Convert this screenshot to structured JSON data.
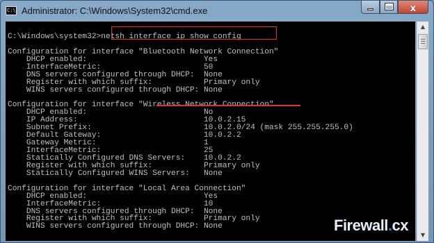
{
  "window": {
    "title": "Administrator: C:\\Windows\\System32\\cmd.exe",
    "icon": "cmd-icon",
    "controls": {
      "minimize": "minimize-icon",
      "maximize": "maximize-icon",
      "close_glyph": "x"
    }
  },
  "console": {
    "lines": [
      "",
      "C:\\Windows\\system32>netsh interface ip show config",
      "",
      "Configuration for interface \"Bluetooth Network Connection\"",
      "    DHCP enabled:                         Yes",
      "    InterfaceMetric:                      50",
      "    DNS servers configured through DHCP:  None",
      "    Register with which suffix:           Primary only",
      "    WINS servers configured through DHCP: None",
      "",
      "Configuration for interface \"Wireless Network Connection\"",
      "    DHCP enabled:                         No",
      "    IP Address:                           10.0.2.15",
      "    Subnet Prefix:                        10.0.2.0/24 (mask 255.255.255.0)",
      "    Default Gateway:                      10.0.2.2",
      "    Gateway Metric:                       1",
      "    InterfaceMetric:                      25",
      "    Statically Configured DNS Servers:    10.0.2.2",
      "    Register with which suffix:           Primary only",
      "    Statically Configured WINS Servers:   None",
      "",
      "Configuration for interface \"Local Area Connection\"",
      "    DHCP enabled:                         Yes",
      "    InterfaceMetric:                      10",
      "    DNS servers configured through DHCP:  None",
      "    Register with which suffix:           Primary only",
      "    WINS servers configured through DHCP: None"
    ]
  },
  "watermark": {
    "part1": "Firewall",
    "dot": ".",
    "part2": "cx"
  }
}
